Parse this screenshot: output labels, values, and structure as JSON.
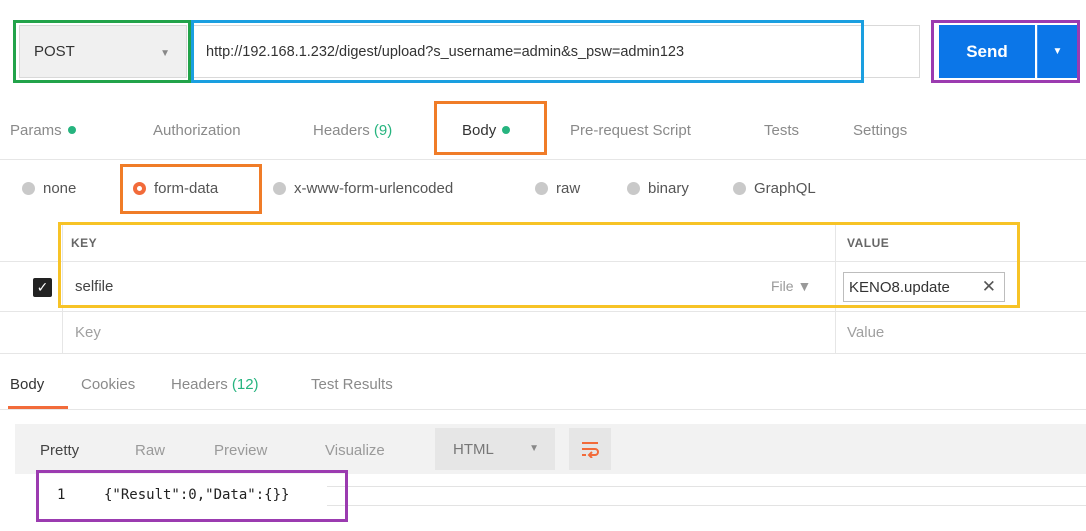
{
  "request": {
    "method": "POST",
    "url": "http://192.168.1.232/digest/upload?s_username=admin&s_psw=admin123",
    "send_label": "Send"
  },
  "request_tabs": {
    "params": "Params",
    "authorization": "Authorization",
    "headers": "Headers",
    "headers_count": "(9)",
    "body": "Body",
    "prerequest": "Pre-request Script",
    "tests": "Tests",
    "settings": "Settings"
  },
  "body_types": {
    "none": "none",
    "form_data": "form-data",
    "urlencoded": "x-www-form-urlencoded",
    "raw": "raw",
    "binary": "binary",
    "graphql": "GraphQL",
    "selected": "form-data"
  },
  "form_table": {
    "key_header": "KEY",
    "value_header": "VALUE",
    "rows": [
      {
        "key": "selfile",
        "type": "File ▼",
        "value": "KENO8.update",
        "checked": true
      }
    ],
    "key_placeholder": "Key",
    "value_placeholder": "Value"
  },
  "response_tabs": {
    "body": "Body",
    "cookies": "Cookies",
    "headers": "Headers",
    "headers_count": "(12)",
    "test_results": "Test Results"
  },
  "response_view": {
    "pretty": "Pretty",
    "raw": "Raw",
    "preview": "Preview",
    "visualize": "Visualize",
    "format": "HTML"
  },
  "response_code": {
    "line_number": "1",
    "text": "{\"Result\":0,\"Data\":{}}"
  },
  "colors": {
    "accent_blue": "#0b76e8",
    "active_orange": "#f26b3a",
    "status_green": "#26b47f",
    "annotation_green": "#22a34a",
    "annotation_blue": "#1a9fe0",
    "annotation_purple": "#9b3bb0",
    "annotation_orange": "#f07c28",
    "annotation_yellow": "#f7c326"
  }
}
